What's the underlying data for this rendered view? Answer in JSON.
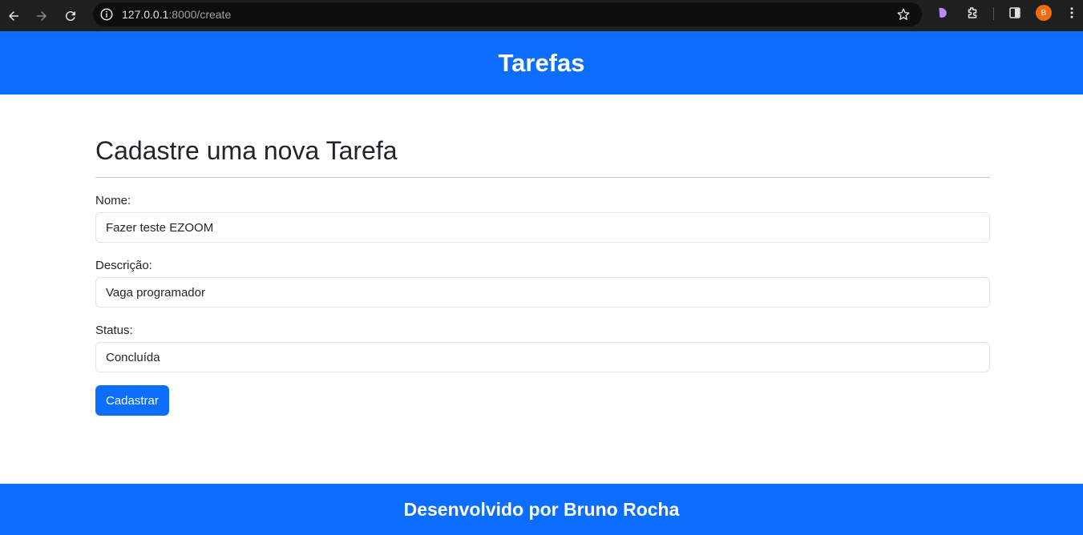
{
  "browser": {
    "url_host": "127.0.0.1",
    "url_path": ":8000/create",
    "profile_initial": "B"
  },
  "header": {
    "title": "Tarefas"
  },
  "main": {
    "title": "Cadastre uma nova Tarefa",
    "fields": [
      {
        "label": "Nome:",
        "value": "Fazer teste EZOOM"
      },
      {
        "label": "Descrição:",
        "value": "Vaga programador"
      },
      {
        "label": "Status:",
        "value": "Concluída"
      }
    ],
    "submit_label": "Cadastrar"
  },
  "footer": {
    "text": "Desenvolvido por Bruno Rocha"
  },
  "colors": {
    "primary": "#0d6efd",
    "chrome_bg": "#1f1f1f",
    "avatar": "#f06a0f"
  }
}
